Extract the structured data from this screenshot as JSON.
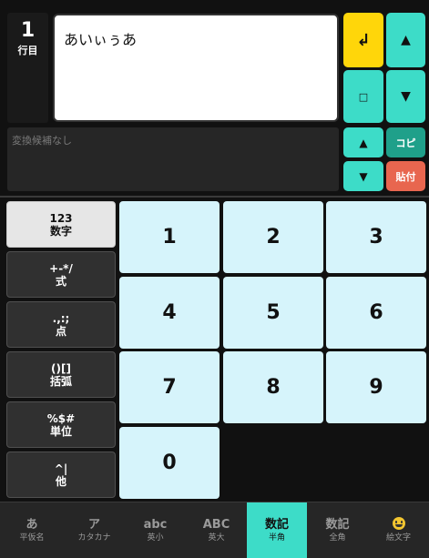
{
  "line_indicator": {
    "number": "1",
    "unit": "行目"
  },
  "input": {
    "value": "あいぃぅあ"
  },
  "controls": {
    "enter": "↲",
    "up": "▲",
    "down": "▼",
    "space": "□",
    "copy": "コピ",
    "paste": "貼付"
  },
  "candidates": {
    "placeholder": "変換候補なし"
  },
  "categories": [
    {
      "top": "123",
      "bottom": "数字"
    },
    {
      "top": "+-*/",
      "bottom": "式"
    },
    {
      "top": ".,:;",
      "bottom": "点"
    },
    {
      "top": "()[]",
      "bottom": "括弧"
    },
    {
      "top": "%$#",
      "bottom": "単位"
    },
    {
      "top": "^|",
      "bottom": "他"
    }
  ],
  "keys": [
    "1",
    "2",
    "3",
    "4",
    "5",
    "6",
    "7",
    "8",
    "9",
    "0"
  ],
  "tabs": [
    {
      "big": "あ",
      "small": "平仮名"
    },
    {
      "big": "ア",
      "small": "カタカナ"
    },
    {
      "big": "abc",
      "small": "英小"
    },
    {
      "big": "ABC",
      "small": "英大"
    },
    {
      "big": "数記",
      "small": "半角"
    },
    {
      "big": "数記",
      "small": "全角"
    },
    {
      "big": "",
      "small": "絵文字",
      "icon": "smiley-emoji-icon"
    }
  ],
  "colors": {
    "accent": "#3ddcc8",
    "enter": "#ffd60a",
    "copy": "#1fa08a",
    "paste": "#e8664f",
    "key": "#d6f4fb"
  },
  "active_category_index": 0,
  "active_tab_index": 4
}
